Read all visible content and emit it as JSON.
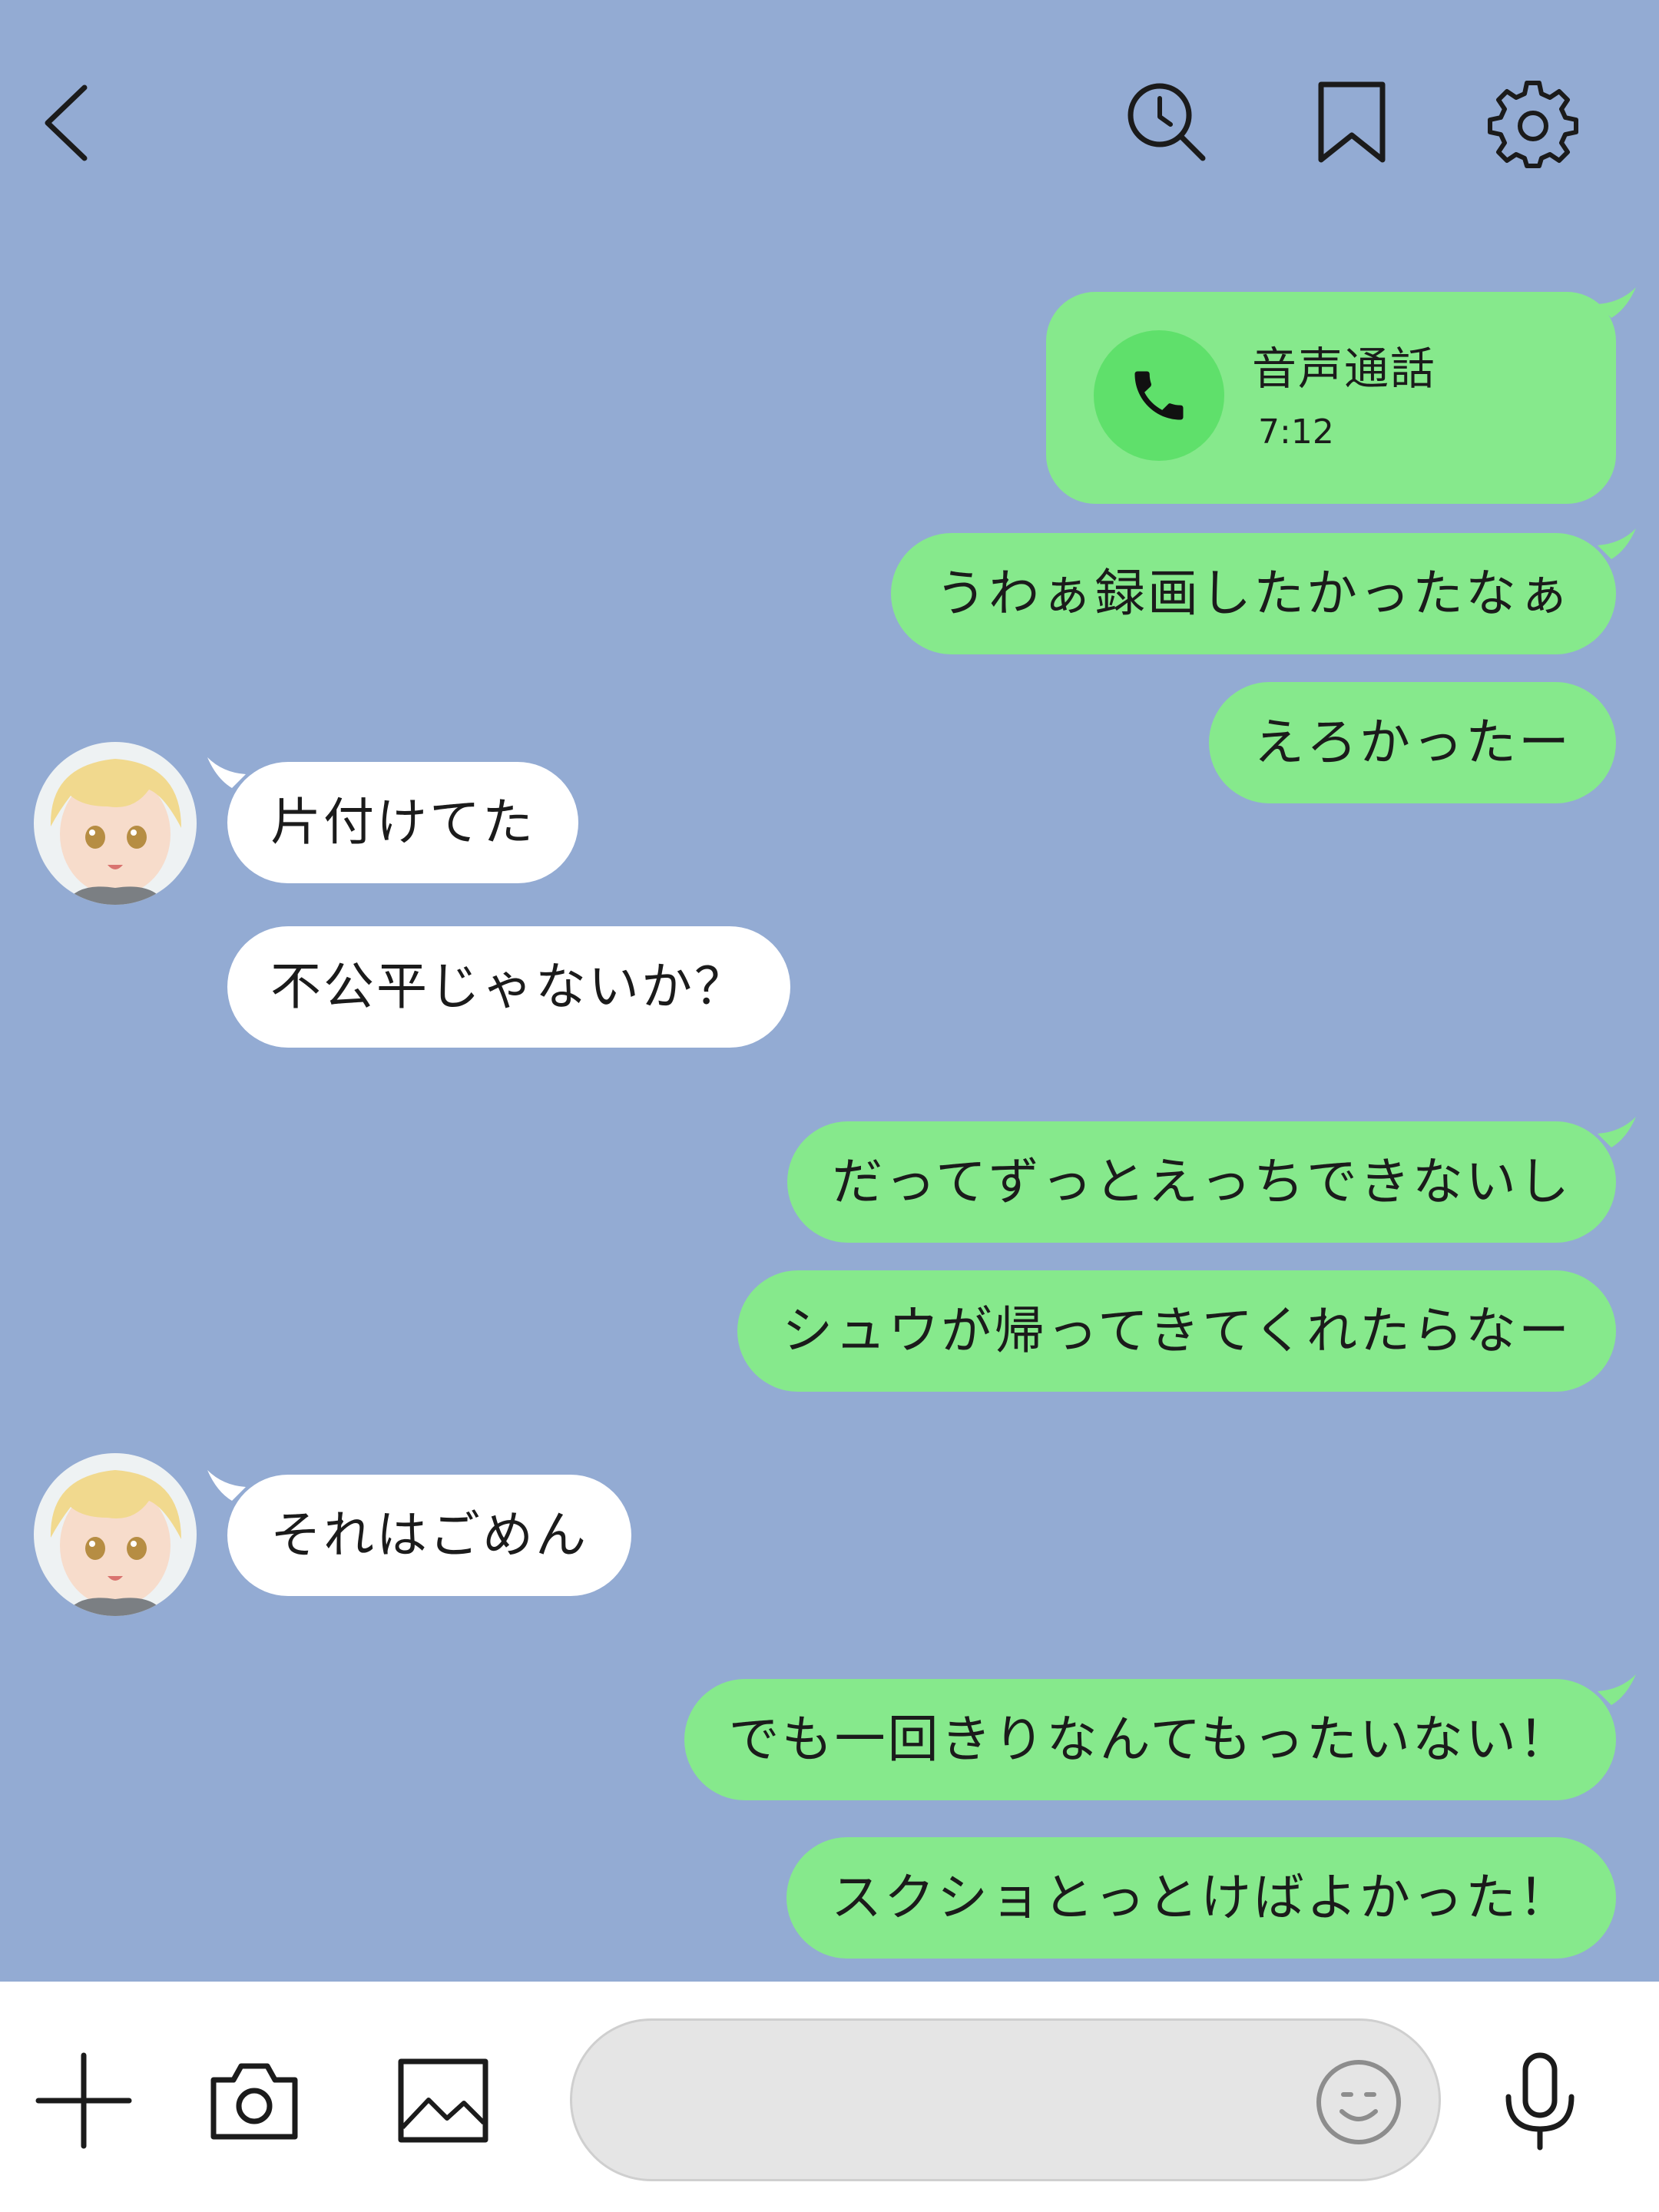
{
  "header": {
    "back_icon": "chevron-left-icon",
    "actions": [
      "history-search-icon",
      "bookmark-icon",
      "gear-icon"
    ]
  },
  "colors": {
    "background": "#93abd3",
    "sent_bubble": "#86e98c",
    "received_bubble": "#ffffff",
    "call_icon_bg": "#5fe06b",
    "input_bar": "#ffffff",
    "input_field": "#e5e5e5"
  },
  "messages": {
    "call": {
      "title": "音声通話",
      "duration": "7:12",
      "icon": "phone-icon"
    },
    "m1": "うわぁ録画したかったなぁ",
    "m2": "えろかったー",
    "m3": "片付けてた",
    "m4": "不公平じゃないか？",
    "m5": "だってずっとえっちできないし",
    "m6": "シュウが帰ってきてくれたらなー",
    "m7": "それはごめん",
    "m8": "でも一回きりなんてもったいない！",
    "m9": "スクショとっとけばよかった！"
  },
  "input_bar": {
    "icons": [
      "plus-icon",
      "camera-icon",
      "image-icon",
      "emoji-icon",
      "microphone-icon"
    ],
    "input_value": "",
    "placeholder": ""
  }
}
